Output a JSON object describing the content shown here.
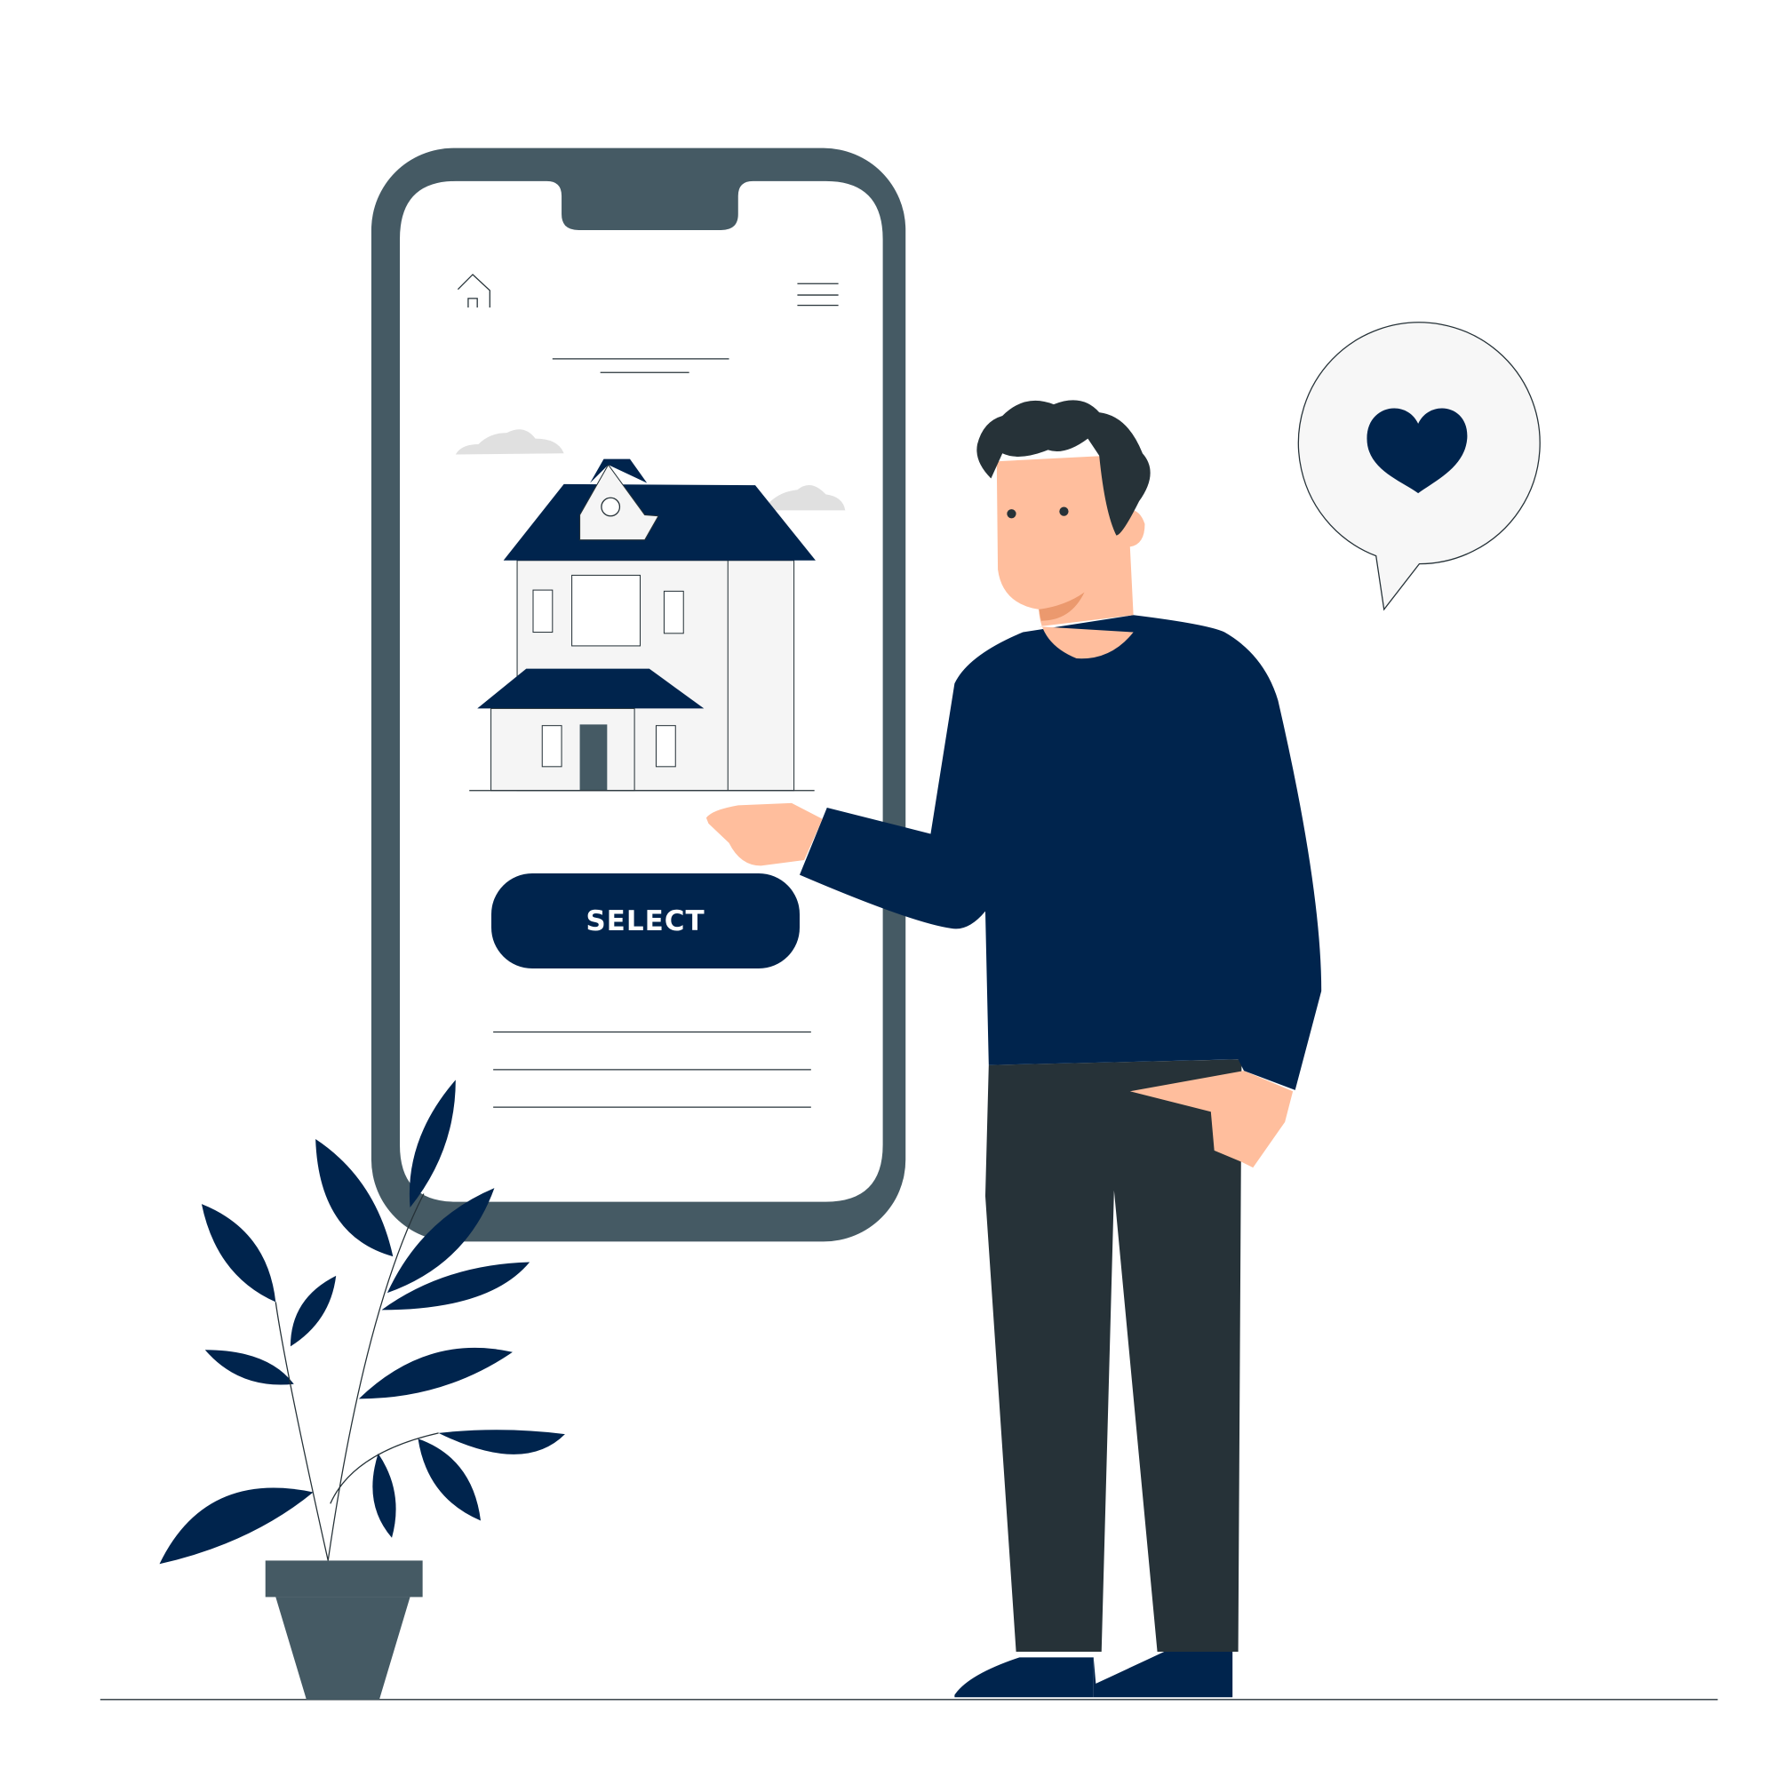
{
  "phone_screen": {
    "select_button_label": "SELECT"
  },
  "colors": {
    "navy": "#00244d",
    "phone_frame": "#455a64",
    "pants": "#263238",
    "skin": "#ffbe9d",
    "house_wall": "#f5f5f5"
  },
  "icons": [
    "home-icon",
    "hamburger-menu-icon",
    "heart-icon"
  ]
}
